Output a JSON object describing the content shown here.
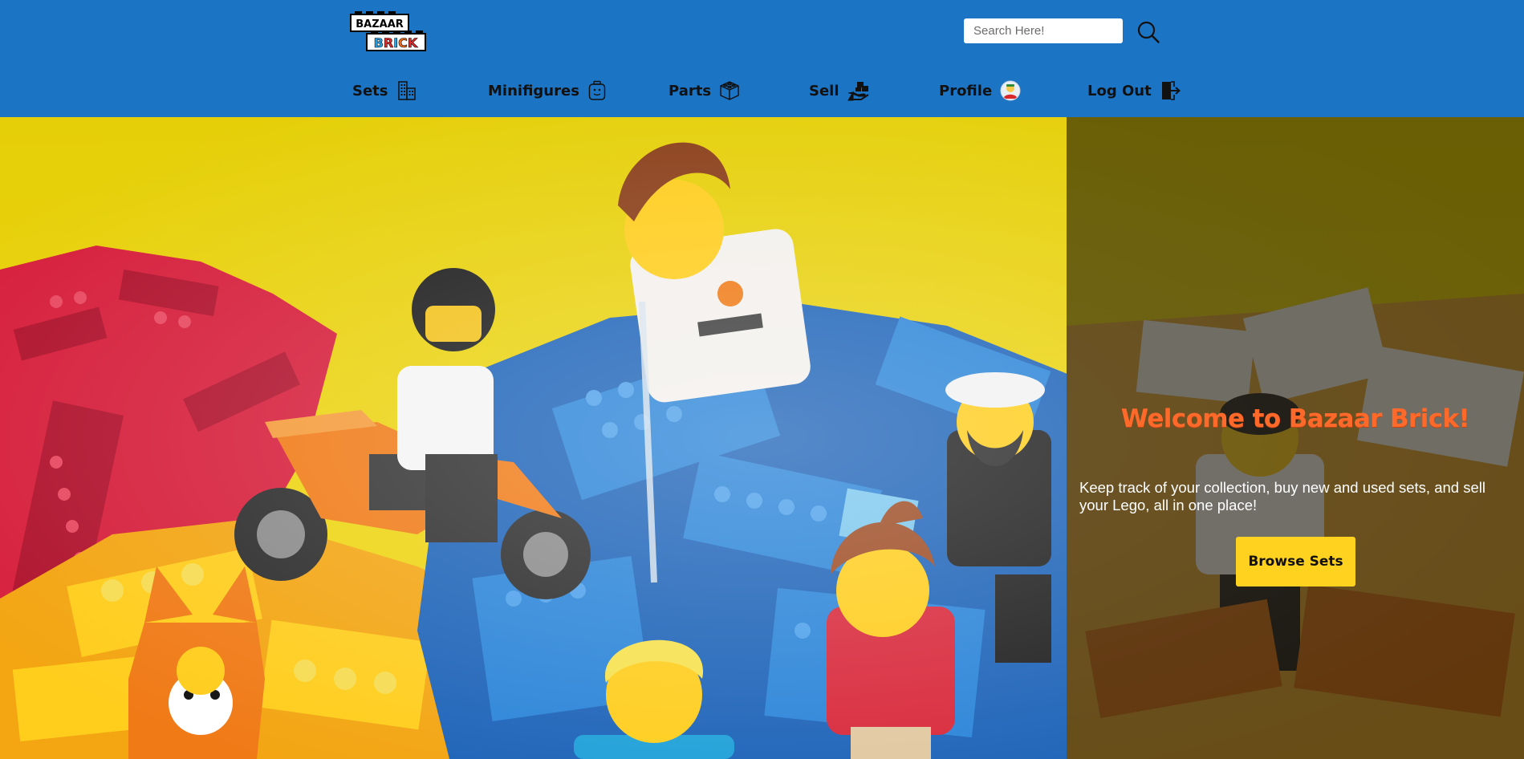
{
  "brand": {
    "logo_top": "BAZAAR",
    "logo_bottom": "BRICK",
    "logo_colors": [
      "#2aa5e6",
      "#e52a2a",
      "#2aa5e6",
      "#f06a1a",
      "#e52a2a"
    ]
  },
  "search": {
    "placeholder": "Search Here!",
    "value": "",
    "icon": "search-icon"
  },
  "nav": {
    "items": [
      {
        "label": "Sets",
        "icon": "building-icon"
      },
      {
        "label": "Minifigures",
        "icon": "minifig-head-icon"
      },
      {
        "label": "Parts",
        "icon": "cube-icon"
      },
      {
        "label": "Sell",
        "icon": "hand-box-icon"
      },
      {
        "label": "Profile",
        "icon": "avatar-icon"
      },
      {
        "label": "Log Out",
        "icon": "logout-icon"
      }
    ]
  },
  "hero": {
    "title": "Welcome to Bazaar Brick!",
    "text": "Keep track of your collection, buy new and used sets, and sell your Lego, all in one place!",
    "button_label": "Browse Sets"
  },
  "colors": {
    "header": "#1b74c4",
    "accent_orange": "#ff6a2b",
    "button_yellow": "#ffd21f",
    "backdrop_yellow": "#f2cf10"
  }
}
